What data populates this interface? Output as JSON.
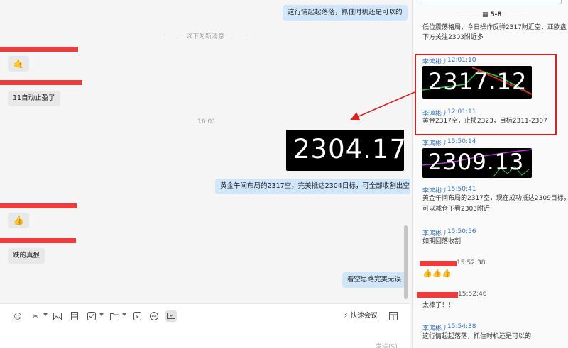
{
  "chat": {
    "msg_top": "这行情起起落落，抓住时机还是可以的",
    "divider": "以下为新消息",
    "msg_stop": "11自动止盈了",
    "time": "16:01",
    "price_image_1": "2304.17",
    "msg_gold": "黄金午间布局的2317空，完美抵达2304目标，可全部收割出空",
    "msg_fall": "跌的真狠",
    "msg_short": "看空思路完美无误"
  },
  "composer": {
    "quick_meet": "快速会议",
    "send": "发送(S)"
  },
  "panel": {
    "date_label": "5-8",
    "intro_line1": "低位震荡格局，今日操作反弹2317附近空，亚欧盘",
    "intro_line2": "下方关注2303附近多",
    "entries": [
      {
        "name": "李鸿彬丿",
        "time": "12:01:10",
        "image_value": "2317.12"
      },
      {
        "name": "李鸿彬丿",
        "time": "12:01:11",
        "text": "黄金2317空，止损2323，目标2311-2307"
      },
      {
        "name": "李鸿彬丿",
        "time": "15:50:14",
        "image_value": "2309.13"
      },
      {
        "name": "李鸿彬丿",
        "time": "15:50:41",
        "text1": "黄金午间布局的2317空，现在成功抵达2309目标，",
        "text2": "可以减仓下看2303附近"
      },
      {
        "name": "李鸿彬丿",
        "time": "15:50:56",
        "text": "如期回落收割"
      },
      {
        "time": "15:52:38",
        "text": "👍👍👍"
      },
      {
        "time": "15:52:46",
        "text": "太棒了！！"
      },
      {
        "name": "李鸿彬丿",
        "time": "15:54:38",
        "text": "这行情起起落落，抓住时机还是可以的"
      }
    ]
  },
  "colors": {
    "accent": "#3377cc",
    "redaction": "#ee3b3b",
    "bubble_self": "#cfe6fb",
    "highlight": "#e02020"
  }
}
